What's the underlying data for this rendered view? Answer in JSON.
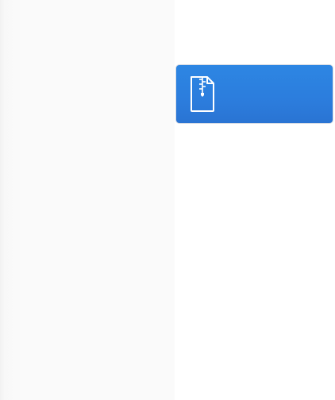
{
  "sidebar": {},
  "main": {
    "archive_item": {
      "icon": "zip-file-icon",
      "label": ""
    }
  },
  "colors": {
    "sidebar_background": "#fafafa",
    "tile_accent": "#2c7ddd",
    "icon_stroke": "#ffffff"
  }
}
